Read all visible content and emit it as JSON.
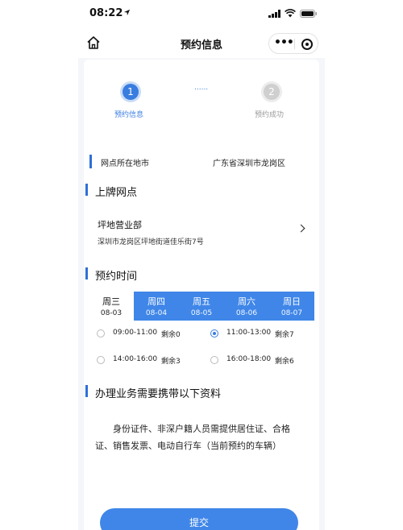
{
  "status_bar": {
    "time": "08:22"
  },
  "nav": {
    "title": "预约信息"
  },
  "steps": [
    {
      "number": "1",
      "label": "预约信息"
    },
    {
      "number": "2",
      "label": "预约成功"
    }
  ],
  "steps_connector": "......",
  "city": {
    "label": "网点所在地市",
    "value": "广东省深圳市龙岗区"
  },
  "branch_section": {
    "title": "上牌网点",
    "name": "坪地营业部",
    "address": "深圳市龙岗区坪地街道佳乐街7号"
  },
  "time_section": {
    "title": "预约时间",
    "days": [
      {
        "name": "周三",
        "date": "08-03"
      },
      {
        "name": "周四",
        "date": "08-04"
      },
      {
        "name": "周五",
        "date": "08-05"
      },
      {
        "name": "周六",
        "date": "08-06"
      },
      {
        "name": "周日",
        "date": "08-07"
      }
    ],
    "selected_day": "周三",
    "slots": [
      {
        "time": "09:00-11:00",
        "remaining": "剩余0"
      },
      {
        "time": "11:00-13:00",
        "remaining": "剩余7"
      },
      {
        "time": "14:00-16:00",
        "remaining": "剩余3"
      },
      {
        "time": "16:00-18:00",
        "remaining": "剩余6"
      }
    ],
    "selected_slot": "11:00-13:00"
  },
  "materials_section": {
    "title": "办理业务需要携带以下资料",
    "text": "身份证件、非深户籍人员需提供居住证、合格证、销售发票、电动自行车（当前预约的车辆）"
  },
  "submit_label": "提交",
  "colors": {
    "primary": "#3f86e8",
    "accent_bar": "#2f6fd6",
    "step_active": "#3a7de0"
  },
  "icons": [
    "location-arrow-icon",
    "signal-icon",
    "wifi-icon",
    "battery-icon",
    "home-icon",
    "more-icon",
    "target-icon",
    "chevron-right-icon"
  ]
}
